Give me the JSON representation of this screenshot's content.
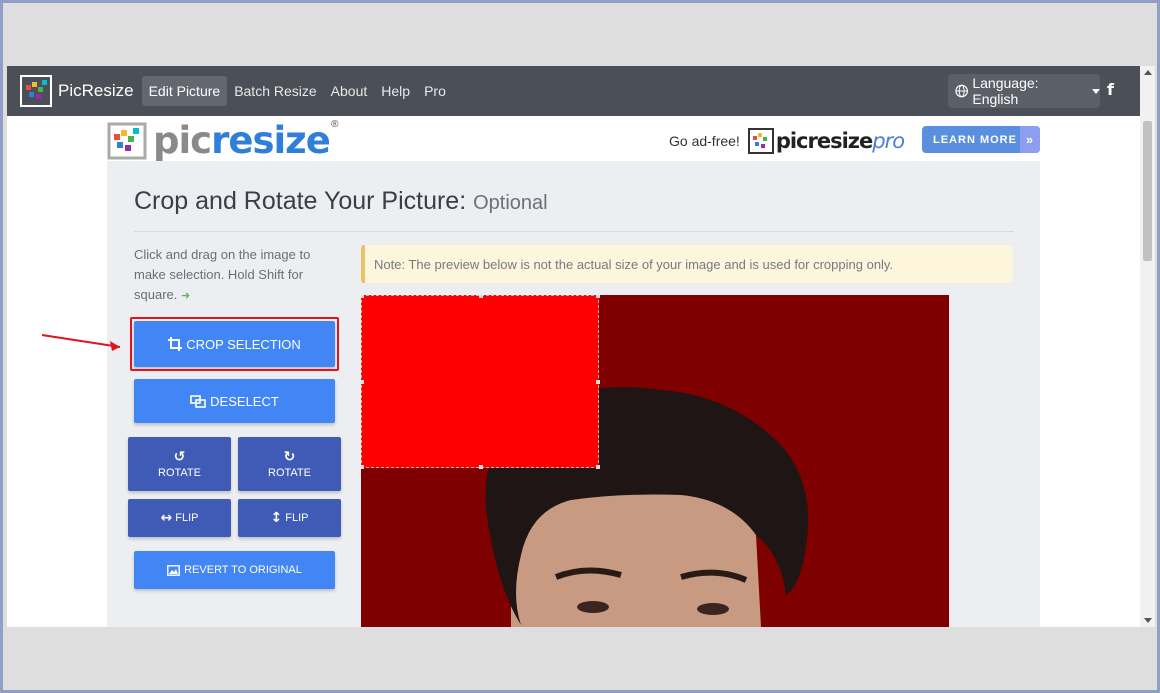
{
  "nav": {
    "brand": "PicResize",
    "links": [
      "Edit Picture",
      "Batch Resize",
      "About",
      "Help",
      "Pro"
    ],
    "language_label": "Language: English",
    "facebook_glyph": "f"
  },
  "header": {
    "logo_pic": "pic",
    "logo_resize": "resize",
    "logo_reg": "®",
    "adfree_label": "Go ad-free!",
    "pro_logo_main": "picresize",
    "pro_logo_suffix": "pro",
    "learn_more": "LEARN MORE",
    "learn_more_arrow": "»"
  },
  "main": {
    "title": "Crop and Rotate Your Picture:",
    "title_optional": "Optional",
    "instructions": "Click and drag on the image to make selection. Hold Shift for square.",
    "note": "Note: The preview below is not the actual size of your image and is used for cropping only."
  },
  "buttons": {
    "crop": "CROP SELECTION",
    "deselect": "DESELECT",
    "rotate_left": "ROTATE",
    "rotate_right": "ROTATE",
    "flip_h": "FLIP",
    "flip_v": "FLIP",
    "revert": "REVERT TO ORIGINAL"
  },
  "icons": {
    "crop": "crop-icon",
    "deselect": "deselect-icon",
    "rotate_left": "rotate-left-icon",
    "rotate_right": "rotate-right-icon",
    "flip_h": "flip-horizontal-icon",
    "flip_v": "flip-vertical-icon",
    "revert": "image-icon",
    "globe": "globe-icon",
    "facebook": "facebook-icon"
  },
  "colors": {
    "navbar": "#4b4f57",
    "button_primary": "#4285f4",
    "button_dark": "#3f5bb5",
    "highlight": "#e0141e",
    "image_background": "#7f0000",
    "selection_fill": "#ff0000"
  }
}
